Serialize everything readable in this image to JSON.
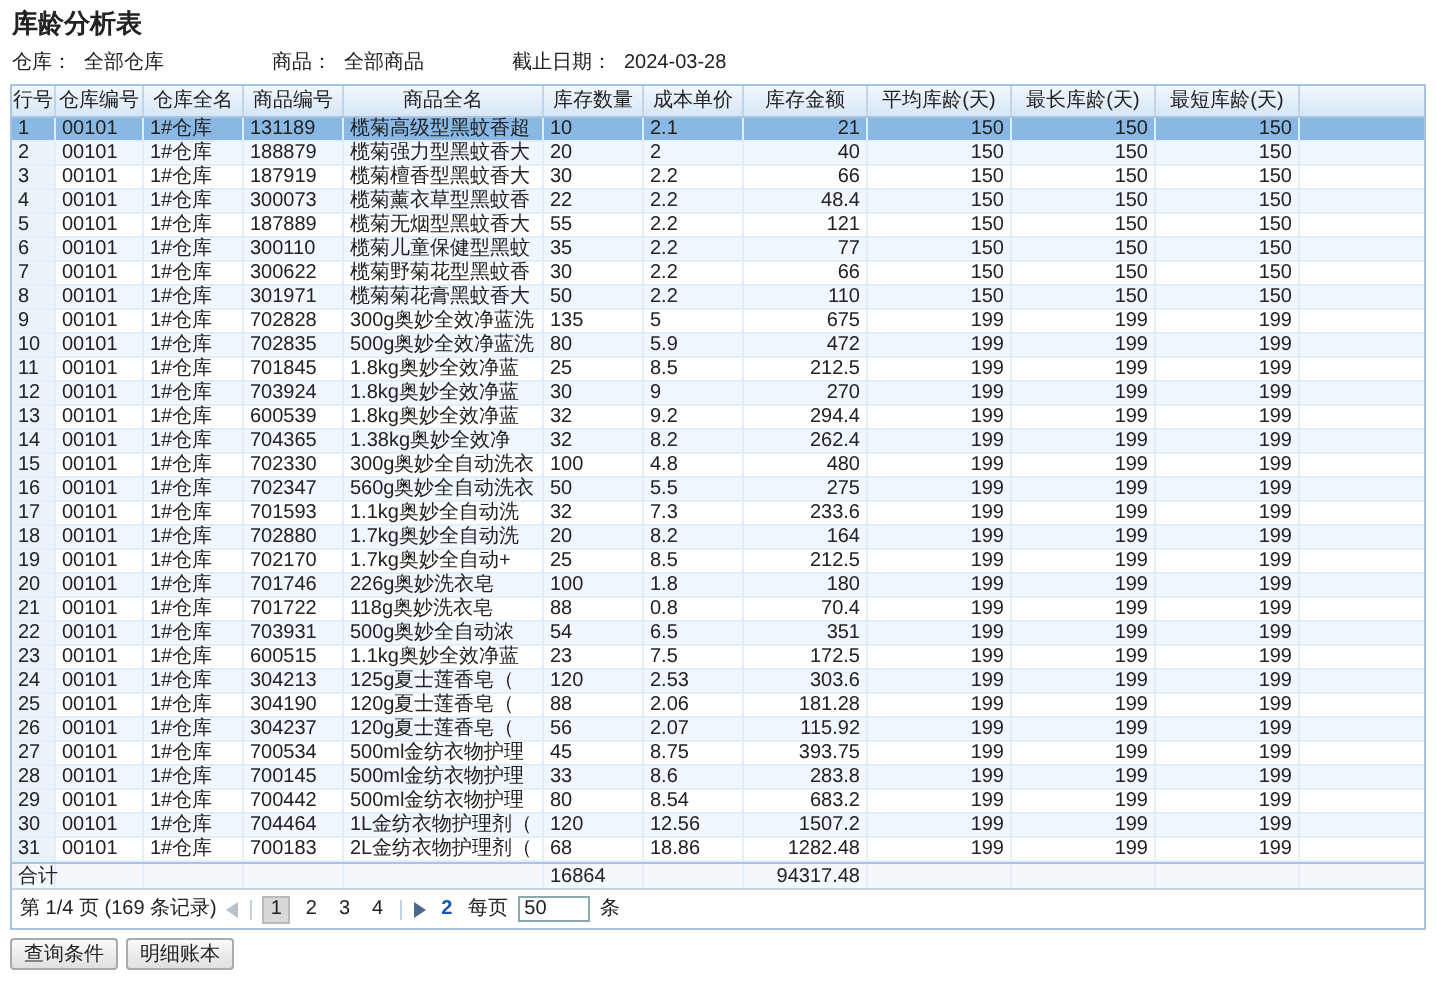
{
  "title": "库龄分析表",
  "filters": [
    {
      "label": "仓库：",
      "value": "全部仓库"
    },
    {
      "label": "商品：",
      "value": "全部商品"
    },
    {
      "label": "截止日期：",
      "value": "2024-03-28"
    }
  ],
  "table": {
    "columns": [
      "行号",
      "仓库编号",
      "仓库全名",
      "商品编号",
      "商品全名",
      "库存数量",
      "成本单价",
      "库存金额",
      "平均库龄(天)",
      "最长库龄(天)",
      "最短库龄(天)"
    ],
    "rows": [
      {
        "selected": true,
        "cells": [
          "1",
          "00101",
          "1#仓库",
          "131189",
          "榄菊高级型黑蚊香超",
          "10",
          "2.1",
          "21",
          "150",
          "150",
          "150"
        ]
      },
      {
        "selected": false,
        "cells": [
          "2",
          "00101",
          "1#仓库",
          "188879",
          "榄菊强力型黑蚊香大",
          "20",
          "2",
          "40",
          "150",
          "150",
          "150"
        ]
      },
      {
        "selected": false,
        "cells": [
          "3",
          "00101",
          "1#仓库",
          "187919",
          "榄菊檀香型黑蚊香大",
          "30",
          "2.2",
          "66",
          "150",
          "150",
          "150"
        ]
      },
      {
        "selected": false,
        "cells": [
          "4",
          "00101",
          "1#仓库",
          "300073",
          "榄菊薰衣草型黑蚊香",
          "22",
          "2.2",
          "48.4",
          "150",
          "150",
          "150"
        ]
      },
      {
        "selected": false,
        "cells": [
          "5",
          "00101",
          "1#仓库",
          "187889",
          "榄菊无烟型黑蚊香大",
          "55",
          "2.2",
          "121",
          "150",
          "150",
          "150"
        ]
      },
      {
        "selected": false,
        "cells": [
          "6",
          "00101",
          "1#仓库",
          "300110",
          "榄菊儿童保健型黑蚊",
          "35",
          "2.2",
          "77",
          "150",
          "150",
          "150"
        ]
      },
      {
        "selected": false,
        "cells": [
          "7",
          "00101",
          "1#仓库",
          "300622",
          "榄菊野菊花型黑蚊香",
          "30",
          "2.2",
          "66",
          "150",
          "150",
          "150"
        ]
      },
      {
        "selected": false,
        "cells": [
          "8",
          "00101",
          "1#仓库",
          "301971",
          "榄菊菊花膏黑蚊香大",
          "50",
          "2.2",
          "110",
          "150",
          "150",
          "150"
        ]
      },
      {
        "selected": false,
        "cells": [
          "9",
          "00101",
          "1#仓库",
          "702828",
          "300g奥妙全效净蓝洗",
          "135",
          "5",
          "675",
          "199",
          "199",
          "199"
        ]
      },
      {
        "selected": false,
        "cells": [
          "10",
          "00101",
          "1#仓库",
          "702835",
          "500g奥妙全效净蓝洗",
          "80",
          "5.9",
          "472",
          "199",
          "199",
          "199"
        ]
      },
      {
        "selected": false,
        "cells": [
          "11",
          "00101",
          "1#仓库",
          "701845",
          "1.8kg奥妙全效净蓝",
          "25",
          "8.5",
          "212.5",
          "199",
          "199",
          "199"
        ]
      },
      {
        "selected": false,
        "cells": [
          "12",
          "00101",
          "1#仓库",
          "703924",
          "1.8kg奥妙全效净蓝",
          "30",
          "9",
          "270",
          "199",
          "199",
          "199"
        ]
      },
      {
        "selected": false,
        "cells": [
          "13",
          "00101",
          "1#仓库",
          "600539",
          "1.8kg奥妙全效净蓝",
          "32",
          "9.2",
          "294.4",
          "199",
          "199",
          "199"
        ]
      },
      {
        "selected": false,
        "cells": [
          "14",
          "00101",
          "1#仓库",
          "704365",
          "1.38kg奥妙全效净",
          "32",
          "8.2",
          "262.4",
          "199",
          "199",
          "199"
        ]
      },
      {
        "selected": false,
        "cells": [
          "15",
          "00101",
          "1#仓库",
          "702330",
          "300g奥妙全自动洗衣",
          "100",
          "4.8",
          "480",
          "199",
          "199",
          "199"
        ]
      },
      {
        "selected": false,
        "cells": [
          "16",
          "00101",
          "1#仓库",
          "702347",
          "560g奥妙全自动洗衣",
          "50",
          "5.5",
          "275",
          "199",
          "199",
          "199"
        ]
      },
      {
        "selected": false,
        "cells": [
          "17",
          "00101",
          "1#仓库",
          "701593",
          "1.1kg奥妙全自动洗",
          "32",
          "7.3",
          "233.6",
          "199",
          "199",
          "199"
        ]
      },
      {
        "selected": false,
        "cells": [
          "18",
          "00101",
          "1#仓库",
          "702880",
          "1.7kg奥妙全自动洗",
          "20",
          "8.2",
          "164",
          "199",
          "199",
          "199"
        ]
      },
      {
        "selected": false,
        "cells": [
          "19",
          "00101",
          "1#仓库",
          "702170",
          "1.7kg奥妙全自动+",
          "25",
          "8.5",
          "212.5",
          "199",
          "199",
          "199"
        ]
      },
      {
        "selected": false,
        "cells": [
          "20",
          "00101",
          "1#仓库",
          "701746",
          "226g奥妙洗衣皂",
          "100",
          "1.8",
          "180",
          "199",
          "199",
          "199"
        ]
      },
      {
        "selected": false,
        "cells": [
          "21",
          "00101",
          "1#仓库",
          "701722",
          "118g奥妙洗衣皂",
          "88",
          "0.8",
          "70.4",
          "199",
          "199",
          "199"
        ]
      },
      {
        "selected": false,
        "cells": [
          "22",
          "00101",
          "1#仓库",
          "703931",
          "500g奥妙全自动浓",
          "54",
          "6.5",
          "351",
          "199",
          "199",
          "199"
        ]
      },
      {
        "selected": false,
        "cells": [
          "23",
          "00101",
          "1#仓库",
          "600515",
          "1.1kg奥妙全效净蓝",
          "23",
          "7.5",
          "172.5",
          "199",
          "199",
          "199"
        ]
      },
      {
        "selected": false,
        "cells": [
          "24",
          "00101",
          "1#仓库",
          "304213",
          "125g夏士莲香皂（",
          "120",
          "2.53",
          "303.6",
          "199",
          "199",
          "199"
        ]
      },
      {
        "selected": false,
        "cells": [
          "25",
          "00101",
          "1#仓库",
          "304190",
          "120g夏士莲香皂（",
          "88",
          "2.06",
          "181.28",
          "199",
          "199",
          "199"
        ]
      },
      {
        "selected": false,
        "cells": [
          "26",
          "00101",
          "1#仓库",
          "304237",
          "120g夏士莲香皂（",
          "56",
          "2.07",
          "115.92",
          "199",
          "199",
          "199"
        ]
      },
      {
        "selected": false,
        "cells": [
          "27",
          "00101",
          "1#仓库",
          "700534",
          "500ml金纺衣物护理",
          "45",
          "8.75",
          "393.75",
          "199",
          "199",
          "199"
        ]
      },
      {
        "selected": false,
        "cells": [
          "28",
          "00101",
          "1#仓库",
          "700145",
          "500ml金纺衣物护理",
          "33",
          "8.6",
          "283.8",
          "199",
          "199",
          "199"
        ]
      },
      {
        "selected": false,
        "cells": [
          "29",
          "00101",
          "1#仓库",
          "700442",
          "500ml金纺衣物护理",
          "80",
          "8.54",
          "683.2",
          "199",
          "199",
          "199"
        ]
      },
      {
        "selected": false,
        "cells": [
          "30",
          "00101",
          "1#仓库",
          "704464",
          "1L金纺衣物护理剂（",
          "120",
          "12.56",
          "1507.2",
          "199",
          "199",
          "199"
        ]
      },
      {
        "selected": false,
        "cells": [
          "31",
          "00101",
          "1#仓库",
          "700183",
          "2L金纺衣物护理剂（",
          "68",
          "18.86",
          "1282.48",
          "199",
          "199",
          "199"
        ]
      }
    ],
    "totals": {
      "label": "合计",
      "quantity": "16864",
      "amount": "94317.48"
    }
  },
  "pager": {
    "info": "第 1/4 页 (169 条记录)",
    "pages": [
      {
        "label": "1",
        "selected": true
      },
      {
        "label": "2",
        "selected": false
      },
      {
        "label": "3",
        "selected": false
      },
      {
        "label": "4",
        "selected": false
      }
    ],
    "jump": "2",
    "per_page_label": "每页",
    "per_page": "50",
    "unit": "条"
  },
  "buttons": [
    "查询条件",
    "明细账本"
  ]
}
